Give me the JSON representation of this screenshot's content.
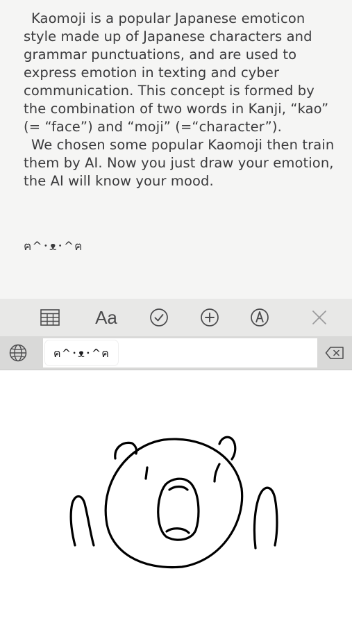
{
  "note": {
    "paragraphs": [
      "Kaomoji is a popular Japanese emoticon style made up of Japanese characters and grammar punctuations, and are used to express emotion in texting and cyber communication. This concept is formed by the combination of two words in Kanji, “kao” (= “face”) and “moji” (=“character”).",
      "We chosen some popular Kaomoji then train them by AI. Now you just draw your emotion, the AI will know your mood."
    ],
    "inserted_kaomoji": "ฅ^･ᴥ･^ฅ"
  },
  "toolbar": {
    "icons": [
      "table-icon",
      "format-text-icon",
      "checklist-icon",
      "add-icon",
      "markup-pen-icon",
      "close-icon"
    ],
    "format_label": "Aa"
  },
  "keyboard": {
    "suggestion": "ฅ^･ᴥ･^ฅ",
    "icons": [
      "globe-icon",
      "backspace-icon"
    ]
  },
  "canvas": {
    "drawing": "hand-drawn surprised bear face with raised paws"
  }
}
